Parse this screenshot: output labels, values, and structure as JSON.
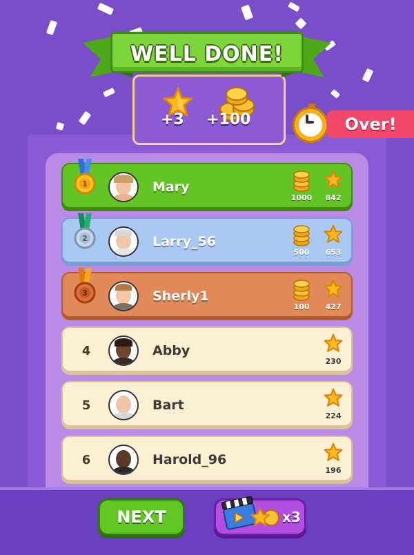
{
  "header": {
    "title": "WELL DONE!",
    "stars_reward": "+3",
    "coins_reward": "+100",
    "round_status": "Over!"
  },
  "leaderboard": [
    {
      "rank": "1",
      "name": "Mary",
      "coins": "1000",
      "stars": "842",
      "medal": "gold"
    },
    {
      "rank": "2",
      "name": "Larry_56",
      "coins": "500",
      "stars": "653",
      "medal": "silver"
    },
    {
      "rank": "3",
      "name": "Sherly1",
      "coins": "100",
      "stars": "427",
      "medal": "bronze"
    },
    {
      "rank": "4",
      "name": "Abby",
      "stars": "230"
    },
    {
      "rank": "5",
      "name": "Bart",
      "stars": "224"
    },
    {
      "rank": "6",
      "name": "Harold_96",
      "stars": "196"
    }
  ],
  "footer": {
    "next_label": "NEXT",
    "video_multiplier": "x3"
  },
  "colors": {
    "background": "#7a4ec8",
    "first_row": "#62c524",
    "second_row": "#a9c8f2",
    "third_row": "#e2895a",
    "other_rows": "#fbf0d4",
    "accent_red": "#f0476a"
  },
  "icons": [
    "star-icon",
    "coin-stack-icon",
    "medal-icon",
    "timer-icon",
    "video-clapper-icon",
    "play-icon"
  ]
}
